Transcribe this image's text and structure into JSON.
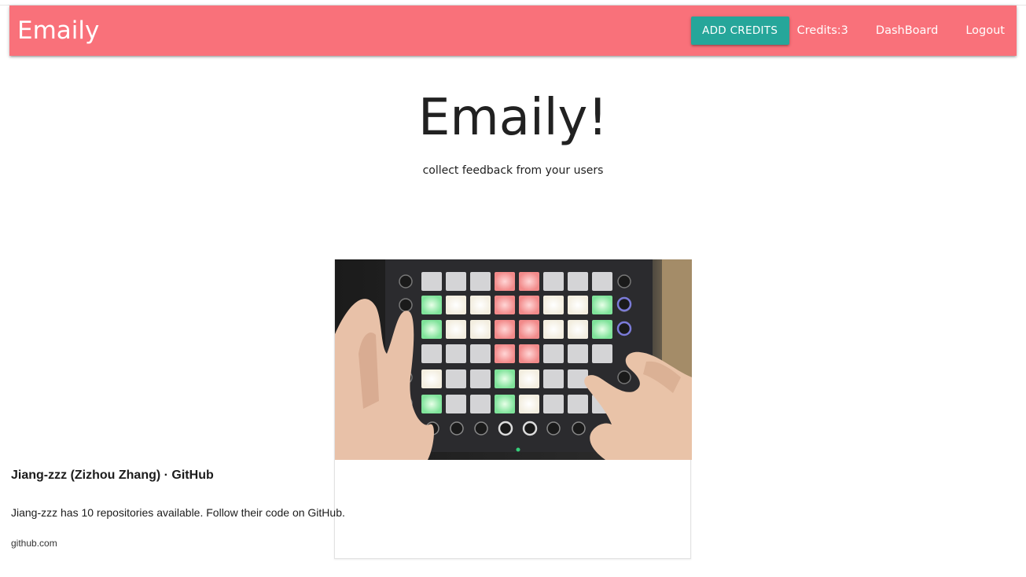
{
  "navbar": {
    "brand": "Emaily",
    "add_credits_label": "ADD CREDITS",
    "credits_text": "Credits:3",
    "dashboard_label": "DashBoard",
    "logout_label": "Logout",
    "background_color": "#f9717a",
    "button_color": "#26a69a"
  },
  "hero": {
    "title": "Emaily!",
    "subtitle": "collect feedback from your users"
  },
  "link_preview": {
    "image_icon": "launchpad-photo",
    "title": "Jiang-zzz (Zizhou Zhang) · GitHub",
    "description": "Jiang-zzz has 10 repositories available. Follow their code on GitHub.",
    "domain": "github.com"
  }
}
